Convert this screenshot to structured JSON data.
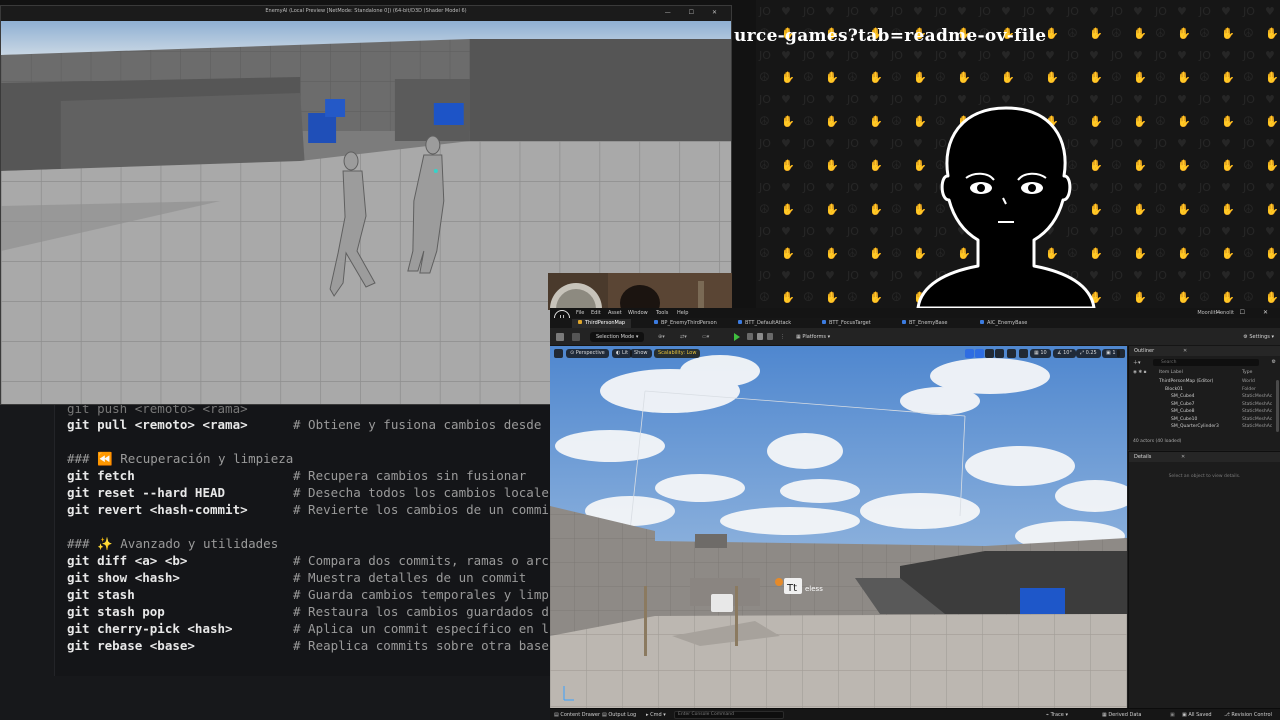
{
  "game_window": {
    "title": "EnemyAI (Local Preview [NetMode: Standalone 0]) (64-bit/D3D (Shader Model 6)",
    "controls": "— ☐ ✕"
  },
  "url_overlay": "urce-games?tab=readme-ov-file",
  "code": {
    "partial_top_line": "git push <remoto> <rama>",
    "lines": [
      {
        "cmd": "git pull <remoto> <rama>",
        "comment": "# Obtiene y fusiona cambios desde"
      },
      {
        "heading": "### ⏪ Recuperación y limpieza"
      },
      {
        "cmd": "git fetch",
        "comment": "# Recupera cambios sin fusionar"
      },
      {
        "cmd": "git reset --hard HEAD",
        "comment": "# Desecha todos los cambios locale"
      },
      {
        "cmd": "git revert <hash-commit>",
        "comment": "# Revierte los cambios de un commi"
      },
      {
        "heading": "### ✨ Avanzado y utilidades"
      },
      {
        "cmd": "git diff <a> <b>",
        "comment": "# Compara dos commits, ramas o arc"
      },
      {
        "cmd": "git show <hash>",
        "comment": "# Muestra detalles de un commit"
      },
      {
        "cmd": "git stash",
        "comment": "# Guarda cambios temporales y limp"
      },
      {
        "cmd": "git stash pop",
        "comment": "# Restaura los cambios guardados d"
      },
      {
        "cmd": "git cherry-pick <hash>",
        "comment": "# Aplica un commit específico en l"
      },
      {
        "cmd": "git rebase <base>",
        "comment": "# Reaplica commits sobre otra base"
      }
    ]
  },
  "ue": {
    "menu": [
      "File",
      "Edit",
      "Asset",
      "Window",
      "Tools",
      "Help"
    ],
    "project_name": "MoonlitMonolit",
    "tabs": [
      {
        "label": "ThirdPersonMap",
        "color": "#e1a72b"
      },
      {
        "label": "BP_EnemyThirdPerson",
        "color": "#3b7be0"
      },
      {
        "label": "BTT_DefaultAttack",
        "color": "#3b7be0"
      },
      {
        "label": "BTT_FocusTarget",
        "color": "#3b7be0"
      },
      {
        "label": "BT_EnemyBase",
        "color": "#3b7be0"
      },
      {
        "label": "AIC_EnemyBase",
        "color": "#3b7be0"
      }
    ],
    "toolbar": {
      "selection_mode": "Selection Mode",
      "platforms": "Platforms",
      "settings": "Settings"
    },
    "viewport": {
      "perspective": "Perspective",
      "lit": "Lit",
      "show": "Show",
      "scalability": "Scalability: Low",
      "grid_snap": "10",
      "angle_snap": "10°",
      "scale_snap": "0.25",
      "camera_speed": "1",
      "billboard_text": "eless"
    },
    "outliner": {
      "title": "Outliner",
      "search_placeholder": "Search",
      "col_label": "Item Label",
      "col_type": "Type",
      "rows": [
        {
          "name": "ThirdPersonMap (Editor)",
          "type": "World"
        },
        {
          "name": "Block01",
          "type": "Folder"
        },
        {
          "name": "SM_Cube4",
          "type": "StaticMeshAc"
        },
        {
          "name": "SM_Cube7",
          "type": "StaticMeshAc"
        },
        {
          "name": "SM_Cube8",
          "type": "StaticMeshAc"
        },
        {
          "name": "SM_Cube10",
          "type": "StaticMeshAc"
        },
        {
          "name": "SM_QuarterCylinder3",
          "type": "StaticMeshAc"
        }
      ],
      "count": "40 actors (40 loaded)"
    },
    "details": {
      "title": "Details",
      "empty_text": "Select an object to view details."
    },
    "statusbar": {
      "content_drawer": "Content Drawer",
      "output_log": "Output Log",
      "cmd": "Cmd",
      "cmd_placeholder": "Enter Console Command",
      "trace": "Trace",
      "derived_data": "Derived Data",
      "all_saved": "All Saved",
      "revision_control": "Revision Control"
    }
  }
}
